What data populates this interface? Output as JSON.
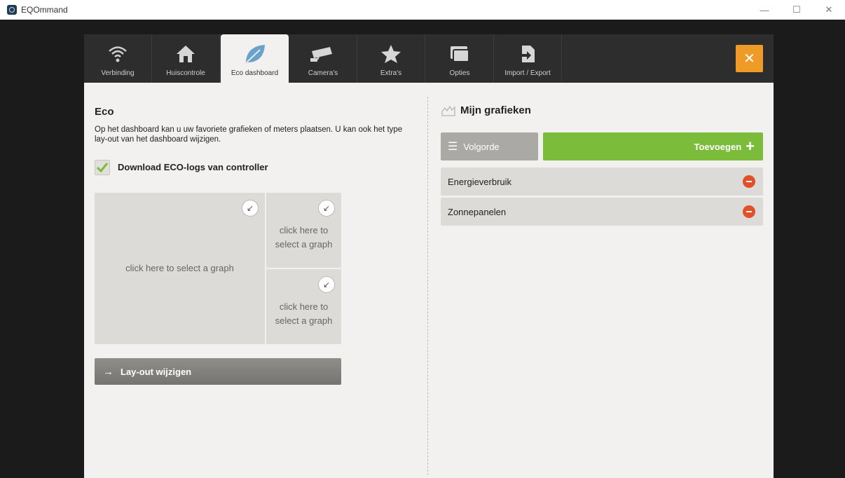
{
  "window": {
    "title": "EQOmmand",
    "controls": {
      "minimize": "—",
      "maximize": "☐",
      "close": "✕"
    }
  },
  "tabs": [
    {
      "label": "Verbinding",
      "icon": "wifi-icon"
    },
    {
      "label": "Huiscontrole",
      "icon": "house-icon"
    },
    {
      "label": "Eco dashboard",
      "icon": "leaf-icon",
      "active": true
    },
    {
      "label": "Camera's",
      "icon": "camera-icon"
    },
    {
      "label": "Extra's",
      "icon": "star-icon"
    },
    {
      "label": "Opties",
      "icon": "windows-icon"
    },
    {
      "label": "Import / Export",
      "icon": "import-export-icon"
    }
  ],
  "close_button": "✕",
  "eco": {
    "title": "Eco",
    "description": "Op het dashboard kan u uw favoriete grafieken of meters plaatsen. U kan ook het type lay-out van het dashboard wijzigen.",
    "download_label": "Download ECO-logs van controller",
    "download_checked": true,
    "cells": {
      "large": "click here to select a graph",
      "small_top": "click here to select a graph",
      "small_bottom": "click here to select a graph"
    },
    "layout_button": "Lay-out wijzigen"
  },
  "graphs": {
    "title": "Mijn grafieken",
    "order_button": "Volgorde",
    "add_button": "Toevoegen",
    "items": [
      {
        "label": "Energieverbruik"
      },
      {
        "label": "Zonnepanelen"
      }
    ]
  },
  "colors": {
    "accent_orange": "#ef9b27",
    "accent_green": "#7cbc3b",
    "remove_red": "#e2502a",
    "leaf_blue": "#6aa3c9"
  }
}
